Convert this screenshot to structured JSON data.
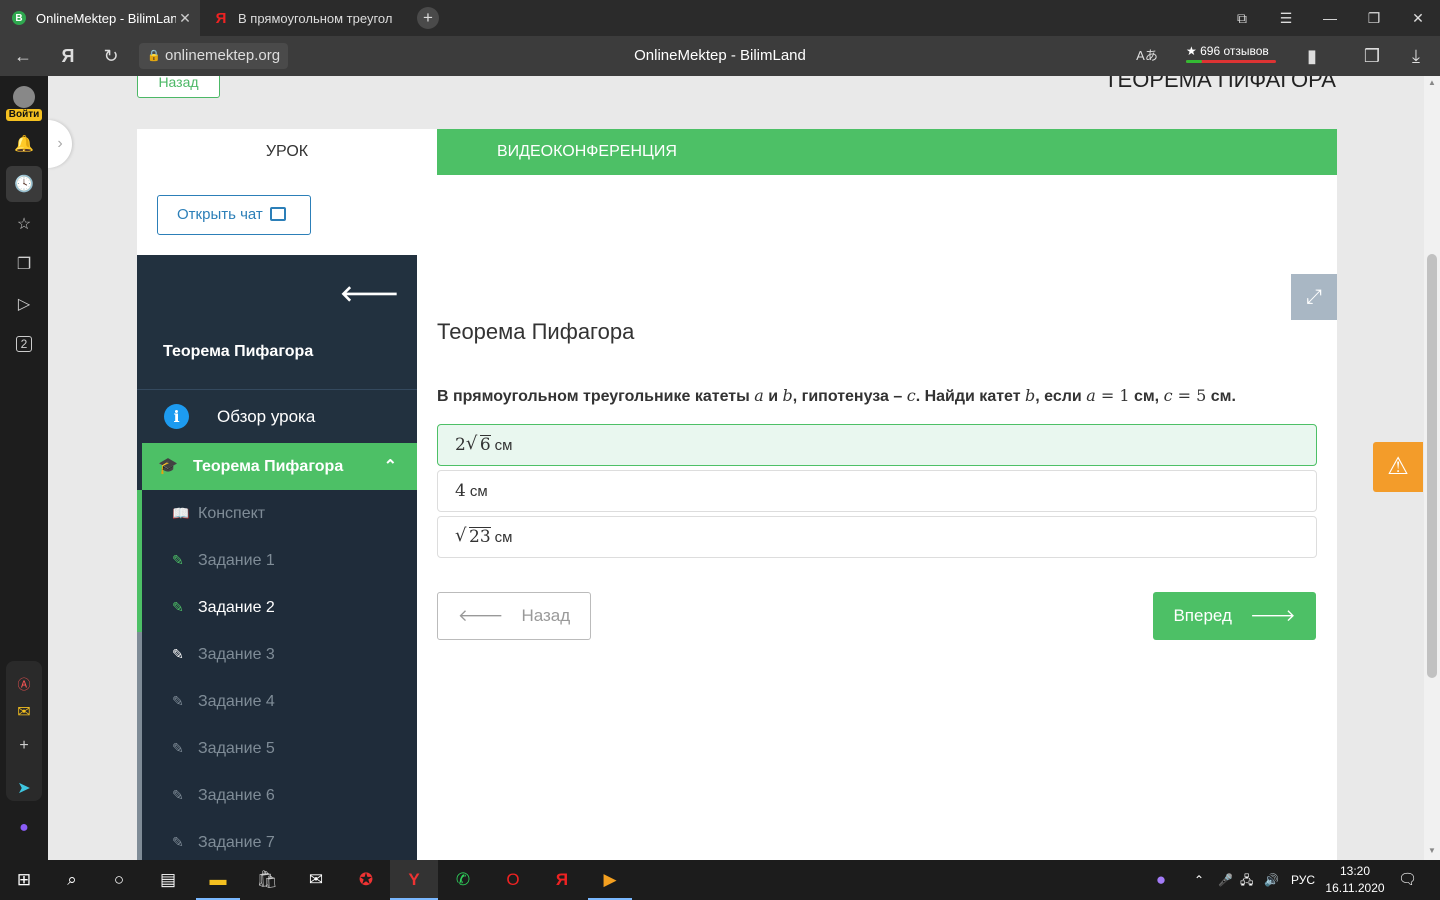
{
  "browser": {
    "tabs": [
      {
        "title": "OnlineMektep - BilimLand",
        "favicon": "bilimland-icon",
        "active": true
      },
      {
        "title": "В прямоугольном треугол",
        "favicon": "yandex-icon",
        "active": false
      }
    ],
    "new_tab": "+",
    "url": "onlinemektep.org",
    "page_title": "OnlineMektep - BilimLand",
    "reviews": "★ 696 отзывов"
  },
  "browser_sidebar": {
    "login_label": "Войти",
    "badge_number": "2"
  },
  "page": {
    "back_top": "Назад",
    "lesson_title_top": "ТЕОРЕМА ПИФАГОРА",
    "tabs": {
      "lesson": "УРОК",
      "videoconference": "ВИДЕОКОНФЕРЕНЦИЯ"
    },
    "open_chat": "Открыть чат",
    "lesson_sidebar": {
      "title": "Теорема Пифагора",
      "overview": "Обзор урока",
      "section": "Теорема Пифагора",
      "items": [
        {
          "label": "Конспект",
          "state": "visited"
        },
        {
          "label": "Задание 1",
          "state": "visited"
        },
        {
          "label": "Задание 2",
          "state": "current"
        },
        {
          "label": "Задание 3",
          "state": "todo"
        },
        {
          "label": "Задание 4",
          "state": "todo"
        },
        {
          "label": "Задание 5",
          "state": "todo"
        },
        {
          "label": "Задание 6",
          "state": "todo"
        },
        {
          "label": "Задание 7",
          "state": "todo"
        }
      ]
    },
    "question": {
      "heading": "Теорема Пифагора",
      "text_parts": {
        "p1": "В прямоугольном треугольнике катеты ",
        "a": "a",
        "and": " и ",
        "b": "b",
        "p2": ", гипотенуза – ",
        "c": "c",
        "p3": ". Найди катет ",
        "b2": "b",
        "p4": ", если ",
        "a_eq": "a",
        "eq1": " = 1",
        "cm1": " см, ",
        "c_eq": "c",
        "eq2": " = 5",
        "cm2": " см."
      },
      "options": [
        {
          "coef": "2",
          "radicand": "6",
          "unit": "см",
          "selected": true
        },
        {
          "value": "4",
          "unit": "см",
          "selected": false
        },
        {
          "coef": "",
          "radicand": "23",
          "unit": "см",
          "selected": false
        }
      ]
    },
    "buttons": {
      "back": "Назад",
      "next": "Вперед"
    }
  },
  "taskbar": {
    "language": "РУС",
    "time": "13:20",
    "date": "16.11.2020"
  },
  "colors": {
    "accent_green": "#4dc066",
    "sidebar_dark": "#22313f",
    "link_blue": "#2c7fb8",
    "warning_orange": "#f39c2a"
  }
}
